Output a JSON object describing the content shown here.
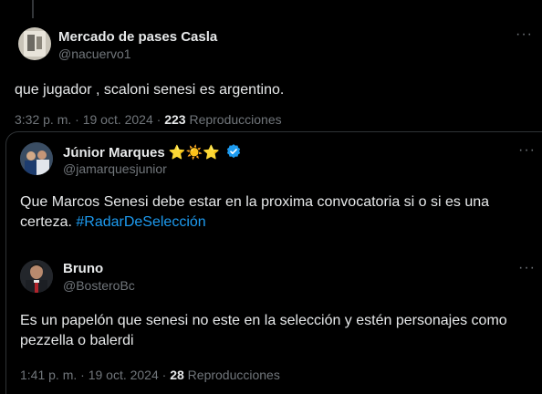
{
  "post": {
    "author_name": "Mercado de pases Casla",
    "author_handle": "@nacuervo1",
    "text": "que jugador , scaloni senesi es argentino.",
    "time": "3:32 p. m. · 19 oct. 2024 ·",
    "views_count": "223",
    "views_label": "Reproducciones"
  },
  "quoted_posts": [
    {
      "author_name": "Júnior Marques",
      "author_handle": "@jamarquesjunior",
      "emoji": "⭐☀️⭐",
      "verified": true,
      "text_main": "Que Marcos Senesi debe estar en la proxima convocatoria si o si es una certeza.",
      "hashtag": "#RadarDeSelección"
    },
    {
      "author_name": "Bruno",
      "author_handle": "@BosteroBc",
      "text": "Es un papelón que senesi no este en la selección y estén personajes como pezzella o balerdi",
      "time": "1:41 p. m. · 19 oct. 2024 ·",
      "views_count": "28",
      "views_label": "Reproducciones"
    }
  ],
  "icons": {
    "more": "more-options-icon",
    "verified": "verified-badge-icon"
  },
  "colors": {
    "background": "#000000",
    "text": "#e7e9ea",
    "muted": "#71767b",
    "link": "#1d9bf0"
  }
}
